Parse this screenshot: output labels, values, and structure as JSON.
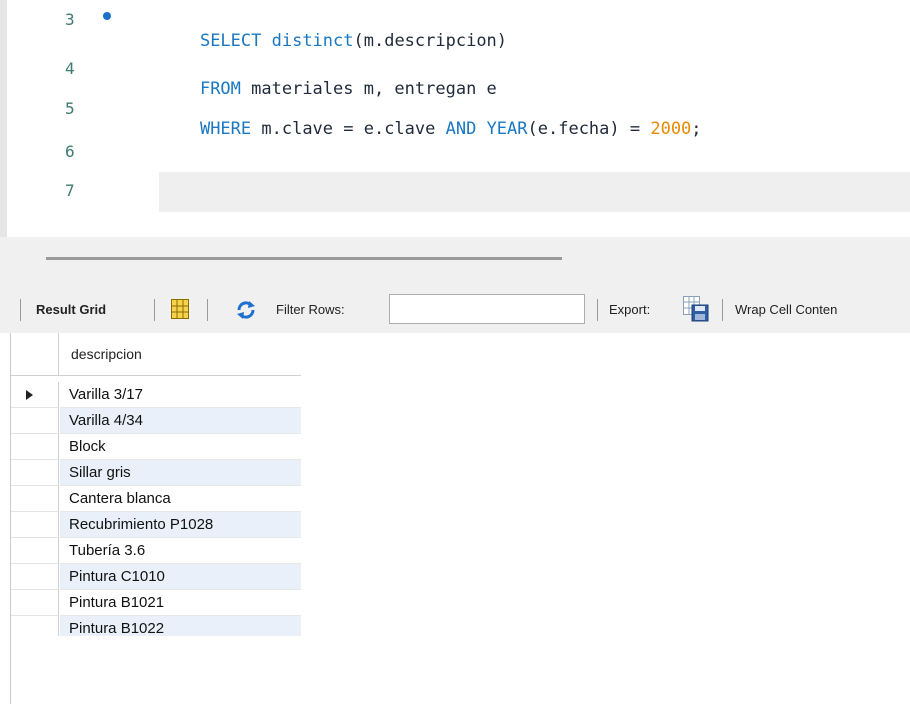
{
  "editor": {
    "lines": [
      {
        "num": "3",
        "tokens": [
          {
            "t": "SELECT ",
            "c": "kw"
          },
          {
            "t": "distinct",
            "c": "kw"
          },
          {
            "t": "(m.descripcion)",
            "c": "plain"
          }
        ]
      },
      {
        "num": "4",
        "tokens": [
          {
            "t": "FROM ",
            "c": "kw"
          },
          {
            "t": "materiales m, entregan e",
            "c": "plain"
          }
        ]
      },
      {
        "num": "5",
        "tokens": [
          {
            "t": "WHERE ",
            "c": "kw"
          },
          {
            "t": "m.clave = e.clave ",
            "c": "plain"
          },
          {
            "t": "AND ",
            "c": "kw"
          },
          {
            "t": "YEAR",
            "c": "kw"
          },
          {
            "t": "(e.fecha) = ",
            "c": "plain"
          },
          {
            "t": "2000",
            "c": "num"
          },
          {
            "t": ";",
            "c": "plain"
          }
        ]
      },
      {
        "num": "6",
        "tokens": []
      },
      {
        "num": "7",
        "tokens": []
      }
    ]
  },
  "toolbar": {
    "result_grid_label": "Result Grid",
    "filter_rows_label": "Filter Rows:",
    "filter_value": "",
    "export_label": "Export:",
    "wrap_label": "Wrap Cell Conten"
  },
  "grid": {
    "column": "descripcion",
    "rows": [
      "Varilla 3/17",
      "Varilla 4/34",
      "Block",
      "Sillar gris",
      "Cantera blanca",
      "Recubrimiento P1028",
      "Tubería 3.6",
      "Pintura C1010",
      "Pintura B1021",
      "Pintura B1022"
    ]
  }
}
